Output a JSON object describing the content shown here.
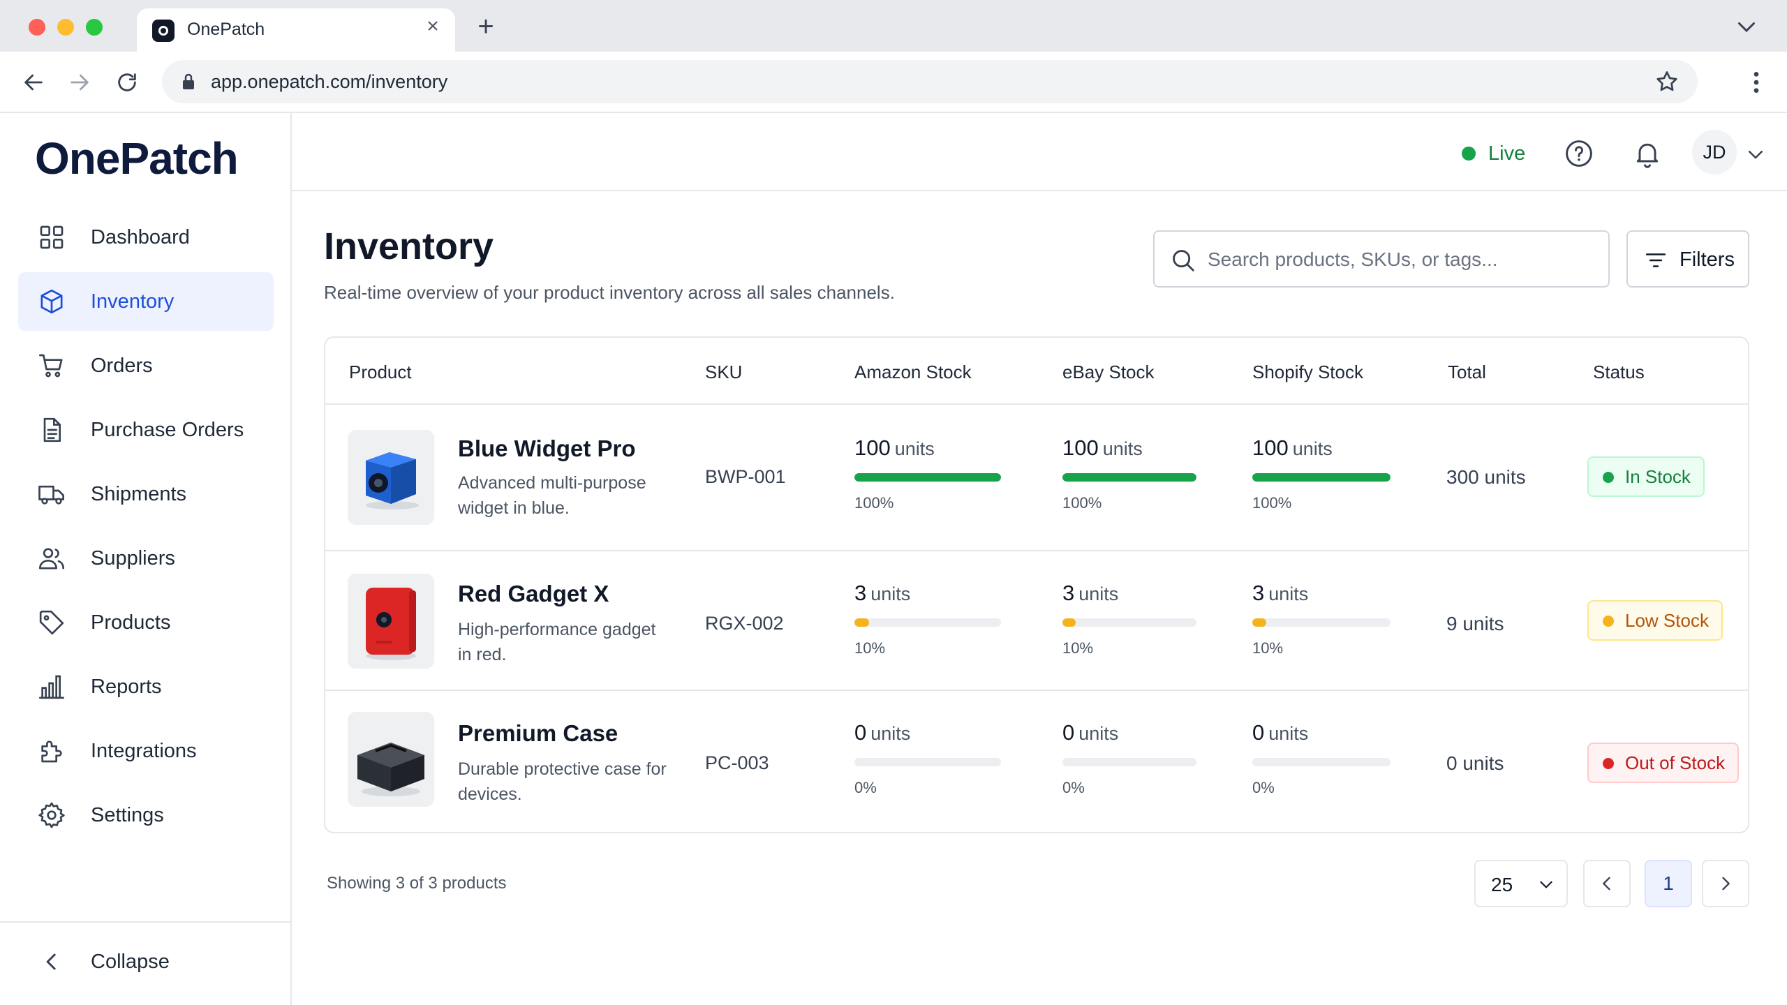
{
  "browser": {
    "tab_title": "OnePatch",
    "tab_close": "×",
    "new_tab": "+",
    "url": "app.onepatch.com/inventory"
  },
  "sidebar": {
    "logo": "OnePatch",
    "items": [
      {
        "label": "Dashboard",
        "icon": "grid-icon"
      },
      {
        "label": "Inventory",
        "icon": "box-icon",
        "active": true
      },
      {
        "label": "Orders",
        "icon": "cart-icon"
      },
      {
        "label": "Purchase Orders",
        "icon": "document-icon"
      },
      {
        "label": "Shipments",
        "icon": "truck-icon"
      },
      {
        "label": "Suppliers",
        "icon": "users-icon"
      },
      {
        "label": "Products",
        "icon": "tag-icon"
      },
      {
        "label": "Reports",
        "icon": "bar-chart-icon"
      },
      {
        "label": "Integrations",
        "icon": "puzzle-icon"
      },
      {
        "label": "Settings",
        "icon": "gear-icon"
      }
    ],
    "collapse_label": "Collapse"
  },
  "header": {
    "live_label": "Live",
    "avatar_initials": "JD"
  },
  "main": {
    "title": "Inventory",
    "subtitle": "Real-time overview of your product inventory across all sales channels.",
    "search_placeholder": "Search products, SKUs, or tags...",
    "filters_label": "Filters"
  },
  "table": {
    "columns": [
      "Product",
      "SKU",
      "Amazon Stock",
      "eBay Stock",
      "Shopify Stock",
      "Total",
      "Status"
    ],
    "unit_label": "units",
    "rows": [
      {
        "name": "Blue Widget Pro",
        "description": "Advanced multi-purpose widget in blue.",
        "sku": "BWP-001",
        "amazon": {
          "value": "100",
          "pct": "100%",
          "fill": 1.0
        },
        "ebay": {
          "value": "100",
          "pct": "100%",
          "fill": 1.0
        },
        "shopify": {
          "value": "100",
          "pct": "100%",
          "fill": 1.0
        },
        "total": "300 units",
        "status": "In Stock"
      },
      {
        "name": "Red Gadget X",
        "description": "High-performance gadget in red.",
        "sku": "RGX-002",
        "amazon": {
          "value": "3",
          "pct": "10%",
          "fill": 0.1
        },
        "ebay": {
          "value": "3",
          "pct": "10%",
          "fill": 0.1
        },
        "shopify": {
          "value": "3",
          "pct": "10%",
          "fill": 0.1
        },
        "total": "9 units",
        "status": "Low Stock"
      },
      {
        "name": "Premium Case",
        "description": "Durable protective case for devices.",
        "sku": "PC-003",
        "amazon": {
          "value": "0",
          "pct": "0%",
          "fill": 0.0
        },
        "ebay": {
          "value": "0",
          "pct": "0%",
          "fill": 0.0
        },
        "shopify": {
          "value": "0",
          "pct": "0%",
          "fill": 0.0
        },
        "total": "0 units",
        "status": "Out of Stock"
      }
    ]
  },
  "footer": {
    "showing": "Showing 3 of 3 products",
    "page_size": "25",
    "current_page": "1"
  },
  "colors": {
    "accent": "#1d4ed8",
    "in_stock": "#16a34a",
    "low_stock": "#f5b21b",
    "out_of_stock": "#dc2626"
  }
}
